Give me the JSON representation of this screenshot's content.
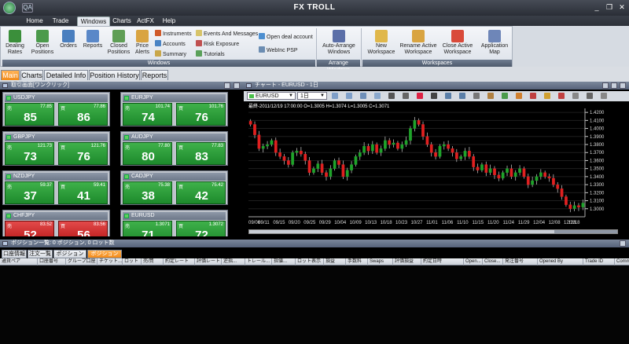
{
  "app": {
    "title": "FX TROLL",
    "quick_access": "QA"
  },
  "window_buttons": {
    "minimize": "_",
    "restore": "❐",
    "close": "✕"
  },
  "menu": [
    "Home",
    "Trade",
    "Windows",
    "Charts",
    "ActFX",
    "Help"
  ],
  "ribbon": {
    "buttons": [
      {
        "label": "Dealing\nRates",
        "icon": "dealing-rates-icon",
        "color": "#3b8f3b"
      },
      {
        "label": "Open\nPositions",
        "icon": "open-positions-icon",
        "color": "#4b9a4b"
      },
      {
        "label": "Orders",
        "icon": "orders-icon",
        "color": "#4a7fbf"
      },
      {
        "label": "Reports",
        "icon": "reports-icon",
        "color": "#5a88c8"
      },
      {
        "label": "Closed\nPositions",
        "icon": "closed-positions-icon",
        "color": "#5f9e55"
      },
      {
        "label": "Price\nAlerts",
        "icon": "price-alerts-icon",
        "color": "#d9a441"
      }
    ],
    "small_col1": [
      "Instruments",
      "Accounts",
      "Summary"
    ],
    "small_col2": [
      "Events And Messages",
      "Risk Exposure",
      "Tutorials"
    ],
    "small_col3": [
      "Open deal account",
      "WebInc PSP"
    ],
    "arrange": "Auto-Arrange\nWindows",
    "workspace_buttons": [
      "New\nWorkspace",
      "Rename Active\nWorkspace",
      "Close Active\nWorkspace",
      "Application\nMap"
    ],
    "groups": [
      "Windows",
      "Arrange Windows",
      "Workspaces"
    ]
  },
  "tabs": [
    "Main",
    "Charts",
    "Detailed Info",
    "Position History",
    "Reports"
  ],
  "dealing": {
    "title": "取引画面[ワンクリック]",
    "sell_label": "売",
    "buy_label": "買",
    "cards": [
      {
        "pair": "USDJPY",
        "sell_small": "77.85",
        "sell_big": "85",
        "buy_small": "77.86",
        "buy_big": "86",
        "red": false
      },
      {
        "pair": "EURJPY",
        "sell_small": "101.74",
        "sell_big": "74",
        "buy_small": "101.76",
        "buy_big": "76",
        "red": false
      },
      {
        "pair": "GBPJPY",
        "sell_small": "121.73",
        "sell_big": "73",
        "buy_small": "121.76",
        "buy_big": "76",
        "red": false
      },
      {
        "pair": "AUDJPY",
        "sell_small": "77.80",
        "sell_big": "80",
        "buy_small": "77.83",
        "buy_big": "83",
        "red": false
      },
      {
        "pair": "NZDJPY",
        "sell_small": "59.37",
        "sell_big": "37",
        "buy_small": "59.41",
        "buy_big": "41",
        "red": false
      },
      {
        "pair": "CADJPY",
        "sell_small": "75.38",
        "sell_big": "38",
        "buy_small": "75.42",
        "buy_big": "42",
        "red": false
      },
      {
        "pair": "CHFJPY",
        "sell_small": "83.52",
        "sell_big": "52",
        "buy_small": "83.56",
        "buy_big": "56",
        "red": true
      },
      {
        "pair": "EURUSD",
        "sell_small": "1.3071",
        "sell_big": "71",
        "buy_small": "1.3072",
        "buy_big": "72",
        "red": false
      }
    ]
  },
  "chart": {
    "title": "チャート - EURUSD - 1日",
    "symbol": "EURUSD",
    "timeframe": "1日",
    "info": "最終-2011/12/19 17:00:00 O=1.3005 H=1.3074 L=1.3005 C=1.3071",
    "colors": {
      "up": "#1fa32a",
      "down": "#e02020",
      "background": "#000000",
      "grid": "#1e1e1e"
    }
  },
  "chart_data": {
    "type": "candlestick",
    "title": "",
    "xlabel": "",
    "ylabel": "",
    "ylim": [
      1.29,
      1.425
    ],
    "yticks": [
      1.42,
      1.41,
      1.4,
      1.39,
      1.38,
      1.37,
      1.36,
      1.35,
      1.34,
      1.33,
      1.32,
      1.31,
      1.3
    ],
    "xticks": [
      "09/06",
      "09/11",
      "09/15",
      "09/20",
      "09/25",
      "09/29",
      "10/04",
      "10/09",
      "10/13",
      "10/18",
      "10/23",
      "10/27",
      "11/01",
      "11/06",
      "11/10",
      "11/15",
      "11/20",
      "11/24",
      "11/29",
      "12/04",
      "12/08",
      "12/13",
      "12/18"
    ],
    "closes": [
      1.405,
      1.392,
      1.375,
      1.378,
      1.38,
      1.385,
      1.37,
      1.365,
      1.36,
      1.355,
      1.37,
      1.372,
      1.368,
      1.36,
      1.345,
      1.35,
      1.356,
      1.345,
      1.34,
      1.35,
      1.36,
      1.355,
      1.34,
      1.348,
      1.355,
      1.365,
      1.37,
      1.378,
      1.372,
      1.38,
      1.37,
      1.375,
      1.385,
      1.38,
      1.382,
      1.375,
      1.38,
      1.385,
      1.4,
      1.41,
      1.405,
      1.39,
      1.38,
      1.37,
      1.365,
      1.378,
      1.38,
      1.375,
      1.37,
      1.362,
      1.365,
      1.372,
      1.365,
      1.352,
      1.348,
      1.355,
      1.345,
      1.35,
      1.342,
      1.338,
      1.345,
      1.35,
      1.34,
      1.345,
      1.35,
      1.34,
      1.33,
      1.335,
      1.34,
      1.345,
      1.34,
      1.338,
      1.33,
      1.325,
      1.315,
      1.305,
      1.3,
      1.304,
      1.302,
      1.3071
    ]
  },
  "positions": {
    "title": "ポジション一覧: 0 ポジション, 0 ロット数",
    "tabs": [
      "口座情報",
      "注文一覧",
      "ポジション総額",
      "ポジション"
    ],
    "columns": [
      "通貨ペア",
      "口座番号",
      "グループ口座",
      "チケット...",
      "ロット",
      "売/買",
      "約定レート",
      "評価レート",
      "逆指...",
      "トレール...",
      "指値...",
      "ロット表示",
      "損益",
      "手数料",
      "Swaps",
      "評価損益",
      "約定日時",
      "Open...",
      "Close...",
      "発注番号",
      "Opened By",
      "Trade ID",
      "Comment"
    ]
  }
}
